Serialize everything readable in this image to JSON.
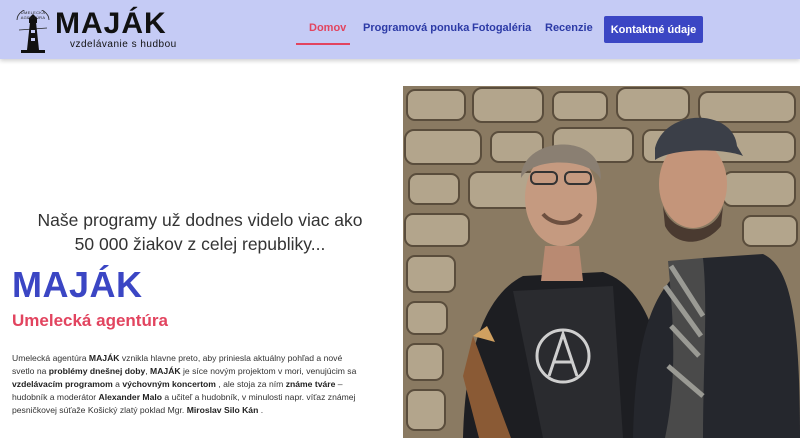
{
  "header": {
    "logo": {
      "title": "MAJÁK",
      "subtitle": "vzdelávanie s hudbou",
      "tiny_text": "UMELECKÁ AGENTÚRA"
    },
    "nav": [
      {
        "label": "Domov",
        "active": true
      },
      {
        "label": "Programová ponuka",
        "active": false
      },
      {
        "label": "Fotogaléria",
        "active": false
      },
      {
        "label": "Recenzie",
        "active": false
      }
    ],
    "contact_button": "Kontaktné údaje"
  },
  "hero": {
    "intro_line1": "Naše programy už dodnes videlo viac ako",
    "intro_line2": "50 000 žiakov z celej republiky...",
    "brand": "MAJÁK",
    "subbrand": "Umelecká agentúra",
    "paragraph": [
      {
        "t": "Umelecká agentúra ",
        "b": false
      },
      {
        "t": "MAJÁK",
        "b": true
      },
      {
        "t": " vznikla hlavne preto, aby priniesla aktuálny pohľad a nové svetlo na ",
        "b": false
      },
      {
        "t": "problémy dnešnej doby",
        "b": true
      },
      {
        "t": ", ",
        "b": false
      },
      {
        "t": "MAJÁK",
        "b": true
      },
      {
        "t": " je síce novým projektom v mori, venujúcim sa ",
        "b": false
      },
      {
        "t": "vzdelávacím programom",
        "b": true
      },
      {
        "t": " a  ",
        "b": false
      },
      {
        "t": "výchovným koncertom",
        "b": true
      },
      {
        "t": " , ale stoja za ním ",
        "b": false
      },
      {
        "t": "známe tváre",
        "b": true
      },
      {
        "t": " – hudobník a moderátor ",
        "b": false
      },
      {
        "t": "Alexander Malo",
        "b": true
      },
      {
        "t": " a učiteľ a hudobník, v minulosti napr. víťaz známej pesničkovej súťaže Košický zlatý poklad Mgr. ",
        "b": false
      },
      {
        "t": "Miroslav Silo Kán",
        "b": true
      },
      {
        "t": " .",
        "b": false
      }
    ]
  },
  "colors": {
    "header_bg": "#c5cbf5",
    "brand_blue": "#3b46c4",
    "accent_red": "#e2445f"
  }
}
